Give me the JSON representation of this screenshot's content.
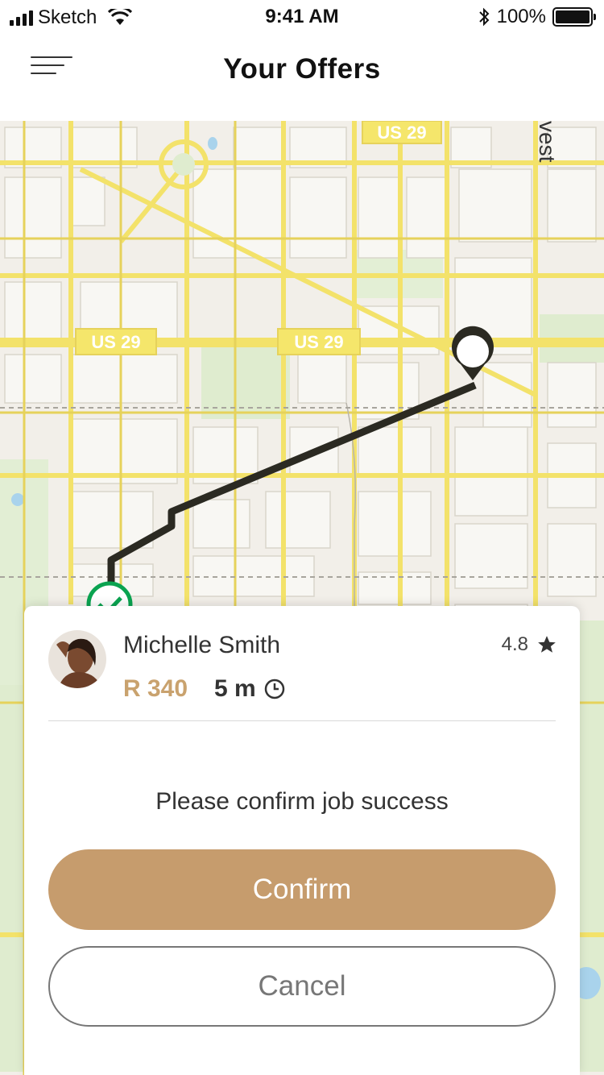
{
  "status_bar": {
    "carrier": "Sketch",
    "time": "9:41 AM",
    "battery": "100%"
  },
  "header": {
    "title": "Your Offers",
    "menu_icon": "hamburger-menu-icon"
  },
  "map": {
    "route_labels": [
      "US 29",
      "US 29",
      "US 29"
    ],
    "edge_label": "vest",
    "start_marker": "checkmark-icon",
    "end_marker": "pin-icon",
    "route_color": "#2b2a22",
    "road_color": "#f5e66b",
    "start_color": "#0aa350"
  },
  "offer": {
    "driver_name": "Michelle Smith",
    "rating": "4.8",
    "price": "R 340",
    "duration": "5 m",
    "prompt": "Please confirm job success",
    "confirm_label": "Confirm",
    "cancel_label": "Cancel",
    "accent_color": "#c69c6d"
  }
}
